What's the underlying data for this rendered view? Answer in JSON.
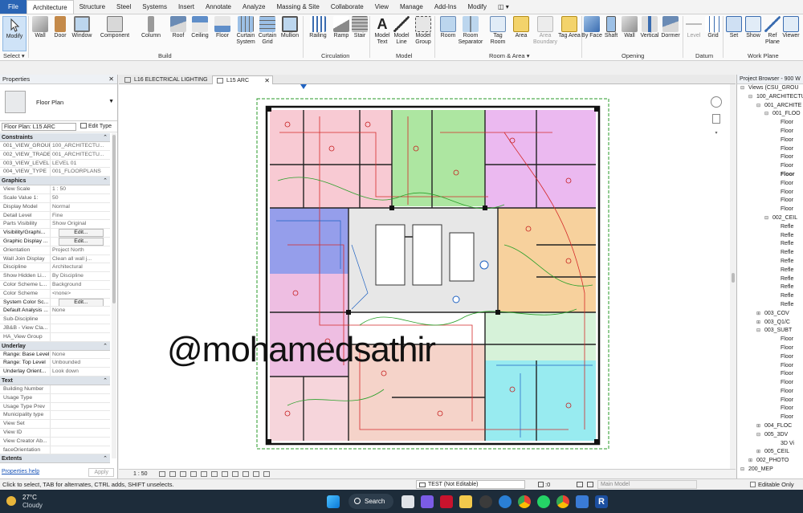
{
  "ribbon_tabs": [
    "File",
    "Architecture",
    "Structure",
    "Steel",
    "Systems",
    "Insert",
    "Annotate",
    "Analyze",
    "Massing & Site",
    "Collaborate",
    "View",
    "Manage",
    "Add-Ins",
    "Modify"
  ],
  "active_tab": "Architecture",
  "ribbon": {
    "select_label": "Select ▾",
    "buttons": {
      "modify": "Modify",
      "wall": "Wall",
      "door": "Door",
      "window": "Window",
      "component": "Component",
      "column": "Column",
      "roof": "Roof",
      "ceiling": "Ceiling",
      "floor": "Floor",
      "curtain_system": "Curtain System",
      "curtain_grid": "Curtain Grid",
      "mullion": "Mullion",
      "railing": "Railing",
      "ramp": "Ramp",
      "stair": "Stair",
      "model_text": "Model Text",
      "model_line": "Model Line",
      "model_group": "Model Group",
      "room": "Room",
      "room_separator": "Room Separator",
      "tag_room": "Tag Room",
      "area": "Area",
      "area_boundary": "Area Boundary",
      "tag_area": "Tag Area",
      "by_face": "By Face",
      "shaft": "Shaft",
      "opening_wall": "Wall",
      "vertical": "Vertical",
      "dormer": "Dormer",
      "level": "Level",
      "grid": "Grid",
      "set": "Set",
      "show": "Show",
      "ref_plane": "Ref Plane",
      "viewer": "Viewer"
    },
    "panels": {
      "build": "Build",
      "circulation": "Circulation",
      "model": "Model",
      "room_area": "Room & Area ▾",
      "opening": "Opening",
      "datum": "Datum",
      "work_plane": "Work Plane"
    }
  },
  "properties": {
    "title": "Properties",
    "type_name": "Floor Plan",
    "instance": "Floor Plan: L15 ARC",
    "edit_type": "Edit Type",
    "sections": [
      {
        "name": "Constraints",
        "rows": [
          {
            "k": "001_VIEW_GROUP",
            "v": "100_ARCHITECTU..."
          },
          {
            "k": "002_VIEW_TRADE",
            "v": "001_ARCHITECTU..."
          },
          {
            "k": "003_VIEW_LEVEL",
            "v": "LEVEL 01"
          },
          {
            "k": "004_VIEW_TYPE",
            "v": "001_FLOORPLANS"
          }
        ]
      },
      {
        "name": "Graphics",
        "rows": [
          {
            "k": "View Scale",
            "v": "1 : 50"
          },
          {
            "k": "Scale Value    1:",
            "v": "50"
          },
          {
            "k": "Display Model",
            "v": "Normal"
          },
          {
            "k": "Detail Level",
            "v": "Fine"
          },
          {
            "k": "Parts Visibility",
            "v": "Show Original"
          },
          {
            "k": "Visibility/Graphi...",
            "v": "Edit...",
            "btn": true
          },
          {
            "k": "Graphic Display ...",
            "v": "Edit...",
            "btn": true
          },
          {
            "k": "Orientation",
            "v": "Project North"
          },
          {
            "k": "Wall Join Display",
            "v": "Clean all wall j..."
          },
          {
            "k": "Discipline",
            "v": "Architectural"
          },
          {
            "k": "Show Hidden Li...",
            "v": "By Discipline"
          },
          {
            "k": "Color Scheme L...",
            "v": "Background"
          },
          {
            "k": "Color Scheme",
            "v": "<none>"
          },
          {
            "k": "System Color Sc...",
            "v": "Edit...",
            "btn": true
          },
          {
            "k": "Default Analysis ...",
            "v": "None"
          },
          {
            "k": "Sub-Discipline",
            "v": ""
          },
          {
            "k": "JB&B - View Cla...",
            "v": ""
          },
          {
            "k": "HA_View Group",
            "v": ""
          }
        ]
      },
      {
        "name": "Underlay",
        "rows": [
          {
            "k": "Range: Base Level",
            "v": "None"
          },
          {
            "k": "Range: Top Level",
            "v": "Unbounded"
          },
          {
            "k": "Underlay Orient...",
            "v": "Look down"
          }
        ]
      },
      {
        "name": "Text",
        "rows": [
          {
            "k": "Building Number",
            "v": ""
          },
          {
            "k": "Usage Type",
            "v": ""
          },
          {
            "k": "Usage Type Prev",
            "v": ""
          },
          {
            "k": "Municipality type",
            "v": ""
          },
          {
            "k": "View Set",
            "v": ""
          },
          {
            "k": "View ID",
            "v": ""
          },
          {
            "k": "View Creator Ab...",
            "v": ""
          },
          {
            "k": "faceOrientation",
            "v": ""
          }
        ]
      },
      {
        "name": "Extents",
        "rows": []
      }
    ],
    "help_link": "Properties help",
    "apply": "Apply"
  },
  "view_tabs": [
    {
      "label": "L16 ELECTRICAL LIGHTING",
      "active": false
    },
    {
      "label": "L15 ARC",
      "active": true
    }
  ],
  "view_scale": "1 : 50",
  "watermark": "@mohamedsathir",
  "project_browser": {
    "title": "Project Browser - 900 W",
    "items": [
      {
        "level": 0,
        "text": "Views (CSU_GROU",
        "tw": "⊟"
      },
      {
        "level": 1,
        "text": "100_ARCHITECTU",
        "tw": "⊟"
      },
      {
        "level": 2,
        "text": "001_ARCHITE",
        "tw": "⊟"
      },
      {
        "level": 3,
        "text": "001_FLOO",
        "tw": "⊟"
      },
      {
        "level": 4,
        "text": "Floor"
      },
      {
        "level": 4,
        "text": "Floor"
      },
      {
        "level": 4,
        "text": "Floor"
      },
      {
        "level": 4,
        "text": "Floor"
      },
      {
        "level": 4,
        "text": "Floor"
      },
      {
        "level": 4,
        "text": "Floor"
      },
      {
        "level": 4,
        "text": "Floor",
        "bold": true
      },
      {
        "level": 4,
        "text": "Floor"
      },
      {
        "level": 4,
        "text": "Floor"
      },
      {
        "level": 4,
        "text": "Floor"
      },
      {
        "level": 4,
        "text": "Floor"
      },
      {
        "level": 3,
        "text": "002_CEIL",
        "tw": "⊟"
      },
      {
        "level": 4,
        "text": "Refle"
      },
      {
        "level": 4,
        "text": "Refle"
      },
      {
        "level": 4,
        "text": "Refle"
      },
      {
        "level": 4,
        "text": "Refle"
      },
      {
        "level": 4,
        "text": "Refle"
      },
      {
        "level": 4,
        "text": "Refle"
      },
      {
        "level": 4,
        "text": "Refle"
      },
      {
        "level": 4,
        "text": "Refle"
      },
      {
        "level": 4,
        "text": "Refle"
      },
      {
        "level": 4,
        "text": "Refle"
      },
      {
        "level": 2,
        "text": "003_COV",
        "tw": "⊞"
      },
      {
        "level": 2,
        "text": "003_Q1/C",
        "tw": "⊞"
      },
      {
        "level": 2,
        "text": "003_SUBT",
        "tw": "⊟"
      },
      {
        "level": 4,
        "text": "Floor"
      },
      {
        "level": 4,
        "text": "Floor"
      },
      {
        "level": 4,
        "text": "Floor"
      },
      {
        "level": 4,
        "text": "Floor"
      },
      {
        "level": 4,
        "text": "Floor"
      },
      {
        "level": 4,
        "text": "Floor"
      },
      {
        "level": 4,
        "text": "Floor"
      },
      {
        "level": 4,
        "text": "Floor"
      },
      {
        "level": 4,
        "text": "Floor"
      },
      {
        "level": 4,
        "text": "Floor"
      },
      {
        "level": 2,
        "text": "004_FLOC",
        "tw": "⊞"
      },
      {
        "level": 2,
        "text": "005_3DV",
        "tw": "⊟"
      },
      {
        "level": 4,
        "text": "3D Vi"
      },
      {
        "level": 2,
        "text": "005_CEIL",
        "tw": "⊞"
      },
      {
        "level": 1,
        "text": "002_PHOTO",
        "tw": "⊞"
      },
      {
        "level": 0,
        "text": "200_MEP",
        "tw": "⊟"
      }
    ]
  },
  "status_bar": {
    "hint": "Click to select, TAB for alternates, CTRL adds, SHIFT unselects.",
    "workset": "TEST (Not Editable)",
    "count": ":0",
    "model": "Main Model",
    "editable_only": "Editable Only"
  },
  "taskbar": {
    "temp": "27°C",
    "weather": "Cloudy",
    "search": "Search"
  }
}
